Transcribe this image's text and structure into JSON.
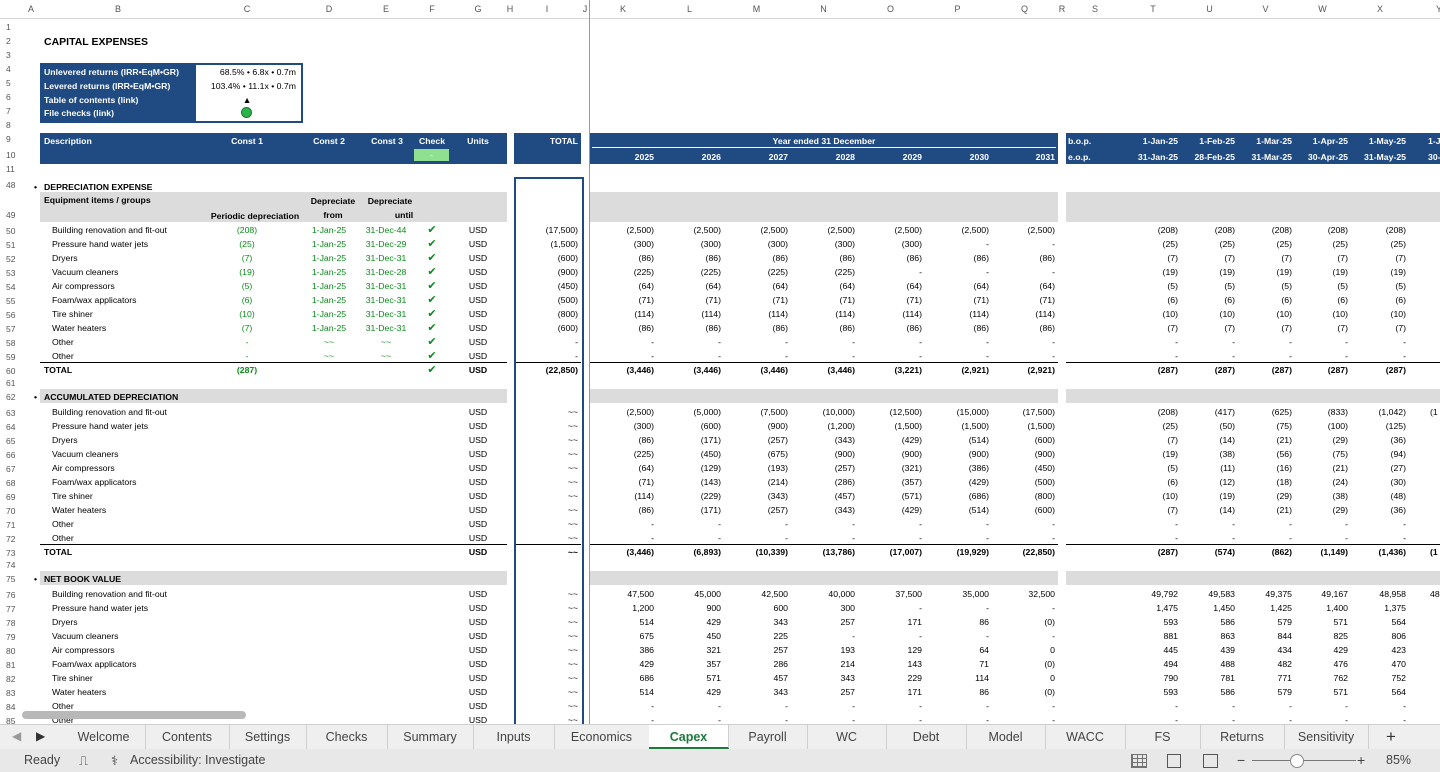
{
  "columns": [
    "A",
    "B",
    "C",
    "D",
    "E",
    "F",
    "G",
    "H",
    "I",
    "J",
    "K",
    "L",
    "M",
    "N",
    "O",
    "P",
    "Q",
    "R",
    "S",
    "T",
    "U",
    "V",
    "W",
    "X",
    "Y"
  ],
  "title": "CAPITAL EXPENSES",
  "summary": [
    {
      "label": "Unlevered returns (IRR•EqM•GR)",
      "value": "68.5% • 6.8x • 0.7m"
    },
    {
      "label": "Levered returns (IRR•EqM•GR)",
      "value": "103.4% • 11.1x • 0.7m"
    },
    {
      "label": "Table of contents (link)",
      "value": "▲"
    },
    {
      "label": "File checks (link)",
      "value": ""
    }
  ],
  "header": {
    "description": "Description",
    "const1": "Const 1",
    "const2": "Const 2",
    "const3": "Const 3",
    "check": "Check",
    "check_value": "-",
    "units": "Units",
    "total": "TOTAL",
    "year_title": "Year ended 31 December",
    "years": [
      "2025",
      "2026",
      "2027",
      "2028",
      "2029",
      "2030",
      "2031"
    ],
    "bop": "b.o.p.",
    "eop": "e.o.p.",
    "month_start": [
      "1-Jan-25",
      "1-Feb-25",
      "1-Mar-25",
      "1-Apr-25",
      "1-May-25",
      "1-J"
    ],
    "month_end": [
      "31-Jan-25",
      "28-Feb-25",
      "31-Mar-25",
      "30-Apr-25",
      "31-May-25",
      "30-J"
    ]
  },
  "dep": {
    "title": "DEPRECIATION EXPENSE",
    "group_label": "Equipment items / groups",
    "periodic": "Periodic depreciation",
    "dep_from_1": "Depreciate",
    "dep_from_2": "from",
    "dep_until_1": "Depreciate",
    "dep_until_2": "until",
    "rows": [
      {
        "n": "50",
        "label": "Building renovation and fit-out",
        "c": "(208)",
        "d": "1-Jan-25",
        "e": "31-Dec-44",
        "f": "✔",
        "u": "USD",
        "tot": "(17,500)",
        "y": [
          "(2,500)",
          "(2,500)",
          "(2,500)",
          "(2,500)",
          "(2,500)",
          "(2,500)",
          "(2,500)"
        ],
        "m": [
          "(208)",
          "(208)",
          "(208)",
          "(208)",
          "(208)"
        ]
      },
      {
        "n": "51",
        "label": "Pressure hand water jets",
        "c": "(25)",
        "d": "1-Jan-25",
        "e": "31-Dec-29",
        "f": "✔",
        "u": "USD",
        "tot": "(1,500)",
        "y": [
          "(300)",
          "(300)",
          "(300)",
          "(300)",
          "(300)",
          "-",
          "-"
        ],
        "m": [
          "(25)",
          "(25)",
          "(25)",
          "(25)",
          "(25)"
        ]
      },
      {
        "n": "52",
        "label": "Dryers",
        "c": "(7)",
        "d": "1-Jan-25",
        "e": "31-Dec-31",
        "f": "✔",
        "u": "USD",
        "tot": "(600)",
        "y": [
          "(86)",
          "(86)",
          "(86)",
          "(86)",
          "(86)",
          "(86)",
          "(86)"
        ],
        "m": [
          "(7)",
          "(7)",
          "(7)",
          "(7)",
          "(7)"
        ]
      },
      {
        "n": "53",
        "label": "Vacuum cleaners",
        "c": "(19)",
        "d": "1-Jan-25",
        "e": "31-Dec-28",
        "f": "✔",
        "u": "USD",
        "tot": "(900)",
        "y": [
          "(225)",
          "(225)",
          "(225)",
          "(225)",
          "-",
          "-",
          "-"
        ],
        "m": [
          "(19)",
          "(19)",
          "(19)",
          "(19)",
          "(19)"
        ]
      },
      {
        "n": "54",
        "label": "Air compressors",
        "c": "(5)",
        "d": "1-Jan-25",
        "e": "31-Dec-31",
        "f": "✔",
        "u": "USD",
        "tot": "(450)",
        "y": [
          "(64)",
          "(64)",
          "(64)",
          "(64)",
          "(64)",
          "(64)",
          "(64)"
        ],
        "m": [
          "(5)",
          "(5)",
          "(5)",
          "(5)",
          "(5)"
        ]
      },
      {
        "n": "55",
        "label": "Foam/wax applicators",
        "c": "(6)",
        "d": "1-Jan-25",
        "e": "31-Dec-31",
        "f": "✔",
        "u": "USD",
        "tot": "(500)",
        "y": [
          "(71)",
          "(71)",
          "(71)",
          "(71)",
          "(71)",
          "(71)",
          "(71)"
        ],
        "m": [
          "(6)",
          "(6)",
          "(6)",
          "(6)",
          "(6)"
        ]
      },
      {
        "n": "56",
        "label": "Tire shiner",
        "c": "(10)",
        "d": "1-Jan-25",
        "e": "31-Dec-31",
        "f": "✔",
        "u": "USD",
        "tot": "(800)",
        "y": [
          "(114)",
          "(114)",
          "(114)",
          "(114)",
          "(114)",
          "(114)",
          "(114)"
        ],
        "m": [
          "(10)",
          "(10)",
          "(10)",
          "(10)",
          "(10)"
        ]
      },
      {
        "n": "57",
        "label": "Water heaters",
        "c": "(7)",
        "d": "1-Jan-25",
        "e": "31-Dec-31",
        "f": "✔",
        "u": "USD",
        "tot": "(600)",
        "y": [
          "(86)",
          "(86)",
          "(86)",
          "(86)",
          "(86)",
          "(86)",
          "(86)"
        ],
        "m": [
          "(7)",
          "(7)",
          "(7)",
          "(7)",
          "(7)"
        ]
      },
      {
        "n": "58",
        "label": "Other",
        "c": "-",
        "d": "~~",
        "e": "~~",
        "f": "✔",
        "u": "USD",
        "tot": "-",
        "y": [
          "-",
          "-",
          "-",
          "-",
          "-",
          "-",
          "-"
        ],
        "m": [
          "-",
          "-",
          "-",
          "-",
          "-"
        ]
      },
      {
        "n": "59",
        "label": "Other",
        "c": "-",
        "d": "~~",
        "e": "~~",
        "f": "✔",
        "u": "USD",
        "tot": "-",
        "y": [
          "-",
          "-",
          "-",
          "-",
          "-",
          "-",
          "-"
        ],
        "m": [
          "-",
          "-",
          "-",
          "-",
          "-"
        ]
      }
    ],
    "total": {
      "n": "60",
      "label": "TOTAL",
      "c": "(287)",
      "f": "✔",
      "u": "USD",
      "tot": "(22,850)",
      "y": [
        "(3,446)",
        "(3,446)",
        "(3,446)",
        "(3,446)",
        "(3,221)",
        "(2,921)",
        "(2,921)"
      ],
      "m": [
        "(287)",
        "(287)",
        "(287)",
        "(287)",
        "(287)"
      ]
    }
  },
  "acc": {
    "title": "ACCUMULATED DEPRECIATION",
    "rows": [
      {
        "n": "63",
        "label": "Building renovation and fit-out",
        "u": "USD",
        "tot": "~~",
        "y": [
          "(2,500)",
          "(5,000)",
          "(7,500)",
          "(10,000)",
          "(12,500)",
          "(15,000)",
          "(17,500)"
        ],
        "m": [
          "(208)",
          "(417)",
          "(625)",
          "(833)",
          "(1,042)",
          "(1"
        ]
      },
      {
        "n": "64",
        "label": "Pressure hand water jets",
        "u": "USD",
        "tot": "~~",
        "y": [
          "(300)",
          "(600)",
          "(900)",
          "(1,200)",
          "(1,500)",
          "(1,500)",
          "(1,500)"
        ],
        "m": [
          "(25)",
          "(50)",
          "(75)",
          "(100)",
          "(125)",
          ""
        ]
      },
      {
        "n": "65",
        "label": "Dryers",
        "u": "USD",
        "tot": "~~",
        "y": [
          "(86)",
          "(171)",
          "(257)",
          "(343)",
          "(429)",
          "(514)",
          "(600)"
        ],
        "m": [
          "(7)",
          "(14)",
          "(21)",
          "(29)",
          "(36)",
          ""
        ]
      },
      {
        "n": "66",
        "label": "Vacuum cleaners",
        "u": "USD",
        "tot": "~~",
        "y": [
          "(225)",
          "(450)",
          "(675)",
          "(900)",
          "(900)",
          "(900)",
          "(900)"
        ],
        "m": [
          "(19)",
          "(38)",
          "(56)",
          "(75)",
          "(94)",
          ""
        ]
      },
      {
        "n": "67",
        "label": "Air compressors",
        "u": "USD",
        "tot": "~~",
        "y": [
          "(64)",
          "(129)",
          "(193)",
          "(257)",
          "(321)",
          "(386)",
          "(450)"
        ],
        "m": [
          "(5)",
          "(11)",
          "(16)",
          "(21)",
          "(27)",
          ""
        ]
      },
      {
        "n": "68",
        "label": "Foam/wax applicators",
        "u": "USD",
        "tot": "~~",
        "y": [
          "(71)",
          "(143)",
          "(214)",
          "(286)",
          "(357)",
          "(429)",
          "(500)"
        ],
        "m": [
          "(6)",
          "(12)",
          "(18)",
          "(24)",
          "(30)",
          ""
        ]
      },
      {
        "n": "69",
        "label": "Tire shiner",
        "u": "USD",
        "tot": "~~",
        "y": [
          "(114)",
          "(229)",
          "(343)",
          "(457)",
          "(571)",
          "(686)",
          "(800)"
        ],
        "m": [
          "(10)",
          "(19)",
          "(29)",
          "(38)",
          "(48)",
          ""
        ]
      },
      {
        "n": "70",
        "label": "Water heaters",
        "u": "USD",
        "tot": "~~",
        "y": [
          "(86)",
          "(171)",
          "(257)",
          "(343)",
          "(429)",
          "(514)",
          "(600)"
        ],
        "m": [
          "(7)",
          "(14)",
          "(21)",
          "(29)",
          "(36)",
          ""
        ]
      },
      {
        "n": "71",
        "label": "Other",
        "u": "USD",
        "tot": "~~",
        "y": [
          "-",
          "-",
          "-",
          "-",
          "-",
          "-",
          "-"
        ],
        "m": [
          "-",
          "-",
          "-",
          "-",
          "-",
          ""
        ]
      },
      {
        "n": "72",
        "label": "Other",
        "u": "USD",
        "tot": "~~",
        "y": [
          "-",
          "-",
          "-",
          "-",
          "-",
          "-",
          "-"
        ],
        "m": [
          "-",
          "-",
          "-",
          "-",
          "-",
          ""
        ]
      }
    ],
    "total": {
      "n": "73",
      "label": "TOTAL",
      "u": "USD",
      "tot": "~~",
      "y": [
        "(3,446)",
        "(6,893)",
        "(10,339)",
        "(13,786)",
        "(17,007)",
        "(19,929)",
        "(22,850)"
      ],
      "m": [
        "(287)",
        "(574)",
        "(862)",
        "(1,149)",
        "(1,436)",
        "(1"
      ]
    }
  },
  "nbv": {
    "title": "NET BOOK VALUE",
    "rows": [
      {
        "n": "76",
        "label": "Building renovation and fit-out",
        "u": "USD",
        "tot": "~~",
        "y": [
          "47,500",
          "45,000",
          "42,500",
          "40,000",
          "37,500",
          "35,000",
          "32,500"
        ],
        "m": [
          "49,792",
          "49,583",
          "49,375",
          "49,167",
          "48,958",
          "48"
        ]
      },
      {
        "n": "77",
        "label": "Pressure hand water jets",
        "u": "USD",
        "tot": "~~",
        "y": [
          "1,200",
          "900",
          "600",
          "300",
          "-",
          "-",
          "-"
        ],
        "m": [
          "1,475",
          "1,450",
          "1,425",
          "1,400",
          "1,375",
          ""
        ]
      },
      {
        "n": "78",
        "label": "Dryers",
        "u": "USD",
        "tot": "~~",
        "y": [
          "514",
          "429",
          "343",
          "257",
          "171",
          "86",
          "(0)"
        ],
        "m": [
          "593",
          "586",
          "579",
          "571",
          "564",
          ""
        ]
      },
      {
        "n": "79",
        "label": "Vacuum cleaners",
        "u": "USD",
        "tot": "~~",
        "y": [
          "675",
          "450",
          "225",
          "-",
          "-",
          "-",
          "-"
        ],
        "m": [
          "881",
          "863",
          "844",
          "825",
          "806",
          ""
        ]
      },
      {
        "n": "80",
        "label": "Air compressors",
        "u": "USD",
        "tot": "~~",
        "y": [
          "386",
          "321",
          "257",
          "193",
          "129",
          "64",
          "0"
        ],
        "m": [
          "445",
          "439",
          "434",
          "429",
          "423",
          ""
        ]
      },
      {
        "n": "81",
        "label": "Foam/wax applicators",
        "u": "USD",
        "tot": "~~",
        "y": [
          "429",
          "357",
          "286",
          "214",
          "143",
          "71",
          "(0)"
        ],
        "m": [
          "494",
          "488",
          "482",
          "476",
          "470",
          ""
        ]
      },
      {
        "n": "82",
        "label": "Tire shiner",
        "u": "USD",
        "tot": "~~",
        "y": [
          "686",
          "571",
          "457",
          "343",
          "229",
          "114",
          "0"
        ],
        "m": [
          "790",
          "781",
          "771",
          "762",
          "752",
          ""
        ]
      },
      {
        "n": "83",
        "label": "Water heaters",
        "u": "USD",
        "tot": "~~",
        "y": [
          "514",
          "429",
          "343",
          "257",
          "171",
          "86",
          "(0)"
        ],
        "m": [
          "593",
          "586",
          "579",
          "571",
          "564",
          ""
        ]
      },
      {
        "n": "84",
        "label": "Other",
        "u": "USD",
        "tot": "~~",
        "y": [
          "-",
          "-",
          "-",
          "-",
          "-",
          "-",
          "-"
        ],
        "m": [
          "-",
          "-",
          "-",
          "-",
          "-",
          ""
        ]
      },
      {
        "n": "85",
        "label": "Other",
        "u": "USD",
        "tot": "~~",
        "y": [
          "-",
          "-",
          "-",
          "-",
          "-",
          "-",
          "-"
        ],
        "m": [
          "-",
          "-",
          "-",
          "-",
          "-",
          ""
        ]
      }
    ]
  },
  "rownums": {
    "r1": "1",
    "r2": "2",
    "r3": "3",
    "r4": "4",
    "r5": "5",
    "r6": "6",
    "r7": "7",
    "r8": "8",
    "r9": "9",
    "r10": "10",
    "r11": "11",
    "r48": "48",
    "r49": "49",
    "r61": "61",
    "r62": "62",
    "r74": "74",
    "r75": "75"
  },
  "tabs": [
    "Welcome",
    "Contents",
    "Settings",
    "Checks",
    "Summary",
    "Inputs",
    "Economics",
    "Capex",
    "Payroll",
    "WC",
    "Debt",
    "Model",
    "WACC",
    "FS",
    "Returns",
    "Sensitivity"
  ],
  "active_tab": "Capex",
  "add_sheet": "+",
  "status": {
    "ready": "Ready",
    "accessibility": "Accessibility: Investigate",
    "zoom": "85%",
    "zoom_level": 0.85
  },
  "colors": {
    "header_blue": "#1f4a82",
    "green": "#0a8a1a",
    "grey_band": "#dcdcdc",
    "check_cell": "#8fe08f"
  }
}
